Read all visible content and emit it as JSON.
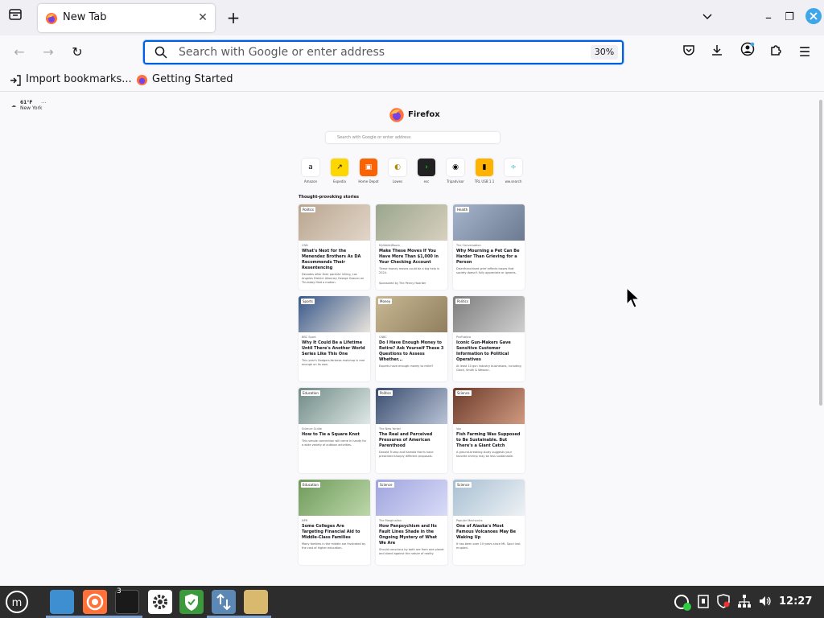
{
  "tab": {
    "title": "New Tab",
    "close_icon": "close-icon"
  },
  "urlbar": {
    "placeholder": "Search with Google or enter address",
    "zoom": "30%"
  },
  "bookmarks": [
    {
      "label": "Import bookmarks..."
    },
    {
      "label": "Getting Started"
    }
  ],
  "newtab": {
    "weather": {
      "temp": "61°F",
      "location": "New York"
    },
    "brand": "Firefox",
    "search_placeholder": "Search with Google or enter address",
    "shortcuts": [
      "Amazon",
      "Expedia",
      "Home Depot",
      "Lowes",
      "esc",
      "Tripadvisor",
      "TRL USB 1.1",
      "ww.search"
    ],
    "section_title": "Thought-provoking stories",
    "cards": [
      {
        "tag": "Politics",
        "source": "CNN",
        "title": "What's Next for the Menendez Brothers As DA Recommends Their Resentencing",
        "excerpt": "Decades after their parents' killing, Los Angeles District Attorney George Gascon on Thursday filed a motion."
      },
      {
        "tag": "",
        "source": "MyWalletRoom",
        "title": "Make These Moves If You Have More Than $1,000 in Your Checking Account",
        "excerpt": "These money moves could be a big help in 2024."
      },
      {
        "tag": "Health",
        "source": "The Conversation",
        "title": "Why Mourning a Pet Can Be Harder Than Grieving for a Person",
        "excerpt": "Disenfranchised grief reflects losses that society doesn't fully appreciate or ignores."
      },
      {
        "tag": "Sports",
        "source": "BBC Sport",
        "title": "Why It Could Be a Lifetime Until There's Another World Series Like This One",
        "excerpt": "This year's Dodgers-Yankees matchup is rare enough on its own."
      },
      {
        "tag": "Money",
        "source": "CNBC",
        "title": "Do I Have Enough Money to Retire? Ask Yourself These 3 Questions to Assess Whether...",
        "excerpt": "Experts have enough money to retire?"
      },
      {
        "tag": "Politics",
        "source": "ProPublica",
        "title": "Iconic Gun-Makers Gave Sensitive Customer Information to Political Operatives",
        "excerpt": "At least 10 gun industry businesses, including Glock, Smith & Wesson."
      },
      {
        "tag": "Education",
        "source": "Science Guide",
        "title": "How to Tie a Square Knot",
        "excerpt": "This simple connection will come in handy for a wide variety of outdoor activities."
      },
      {
        "tag": "Politics",
        "source": "The New Yorker",
        "title": "The Real and Perceived Pressures of American Parenthood",
        "excerpt": "Donald Trump and Kamala Harris have presented sharply different proposals."
      },
      {
        "tag": "Science",
        "source": "Vox",
        "title": "Fish Farming Was Supposed to Be Sustainable. But There's a Giant Catch",
        "excerpt": "A ground-breaking study suggests your favorite shrimp may be less sustainable."
      },
      {
        "tag": "Education",
        "source": "NPR",
        "title": "Some Colleges Are Targeting Financial Aid to Middle-Class Families",
        "excerpt": "Many families in the middle are frustrated by the cost of higher education."
      },
      {
        "tag": "Science",
        "source": "The Marginalian",
        "title": "How Panpsychism and Its Fault Lines Shade in the Ongoing Mystery of What We Are",
        "excerpt": "Should conscious by both are from one planet and stand against the nature of reality."
      },
      {
        "tag": "Science",
        "source": "Popular Mechanics",
        "title": "One of Alaska's Most Famous Volcanoes May Be Waking Up",
        "excerpt": "It has been over 10 years since Mt. Spurr last erupted."
      }
    ],
    "sponsored": "Sponsored by The Penny Hoarder"
  },
  "taskbar": {
    "time": "12:27",
    "terminal_badge": "3"
  },
  "colors": {
    "accent": "#0061e0",
    "taskbar": "#2d2d2d"
  }
}
